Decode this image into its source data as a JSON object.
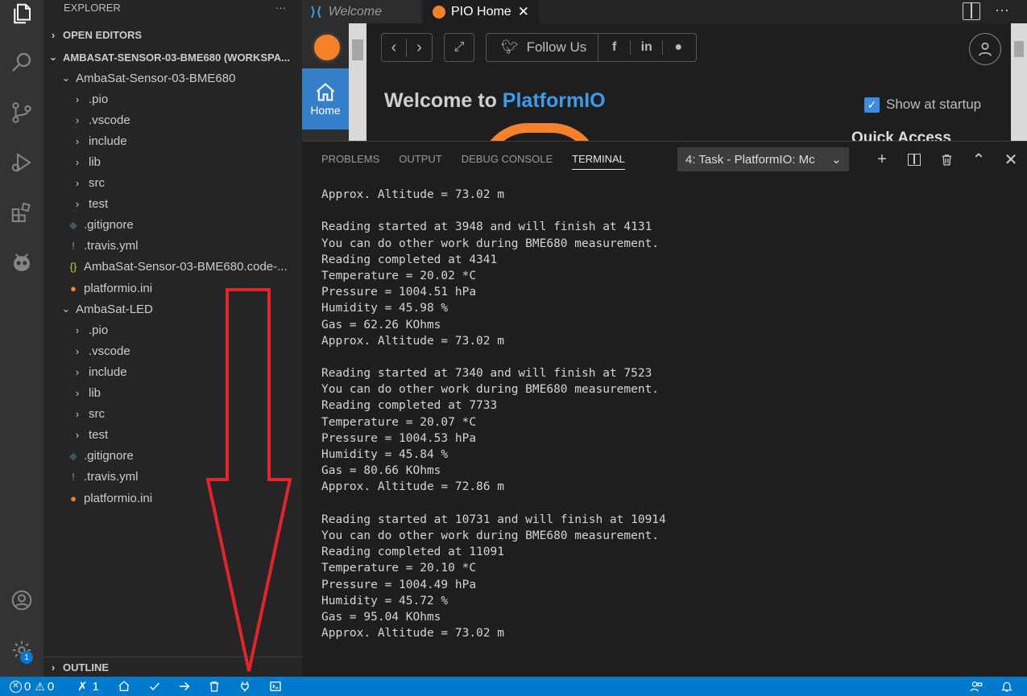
{
  "sidebar": {
    "title": "EXPLORER",
    "more": "···",
    "open_editors": "OPEN EDITORS",
    "workspace": "AMBASAT-SENSOR-03-BME680 (WORKSPA...",
    "projects": [
      {
        "name": "AmbaSat-Sensor-03-BME680",
        "items": [
          ".pio",
          ".vscode",
          "include",
          "lib",
          "src",
          "test",
          ".gitignore",
          ".travis.yml",
          "AmbaSat-Sensor-03-BME680.code-...",
          "platformio.ini"
        ]
      },
      {
        "name": "AmbaSat-LED",
        "items": [
          ".pio",
          ".vscode",
          "include",
          "lib",
          "src",
          "test",
          ".gitignore",
          ".travis.yml",
          "platformio.ini"
        ]
      }
    ],
    "outline": "OUTLINE",
    "settings_badge": "1"
  },
  "tabs": {
    "welcome": "Welcome",
    "pio_home": "PIO Home",
    "close": "✕"
  },
  "pio": {
    "home_label": "Home",
    "follow_us": "Follow Us",
    "welcome_prefix": "Welcome to ",
    "welcome_brand": "PlatformIO",
    "show_at_startup": "Show at startup",
    "quick_access": "Quick Access"
  },
  "panel": {
    "tabs": [
      "PROBLEMS",
      "OUTPUT",
      "DEBUG CONSOLE",
      "TERMINAL"
    ],
    "task_select": "4: Task - PlatformIO: Mc",
    "terminal_lines": [
      "Approx. Altitude = 73.02 m",
      "",
      "Reading started at 3948 and will finish at 4131",
      "You can do other work during BME680 measurement.",
      "Reading completed at 4341",
      "Temperature = 20.02 *C",
      "Pressure = 1004.51 hPa",
      "Humidity = 45.98 %",
      "Gas = 62.26 KOhms",
      "Approx. Altitude = 73.02 m",
      "",
      "Reading started at 7340 and will finish at 7523",
      "You can do other work during BME680 measurement.",
      "Reading completed at 7733",
      "Temperature = 20.07 *C",
      "Pressure = 1004.53 hPa",
      "Humidity = 45.84 %",
      "Gas = 80.66 KOhms",
      "Approx. Altitude = 72.86 m",
      "",
      "Reading started at 10731 and will finish at 10914",
      "You can do other work during BME680 measurement.",
      "Reading completed at 11091",
      "Temperature = 20.10 *C",
      "Pressure = 1004.49 hPa",
      "Humidity = 45.72 %",
      "Gas = 95.04 KOhms",
      "Approx. Altitude = 73.02 m"
    ]
  },
  "statusbar": {
    "errors": "0",
    "warnings": "0",
    "tasks": "1"
  },
  "colors": {
    "accent": "#007acc",
    "pio_orange": "#f5822a",
    "annotation_red": "#e0252b"
  }
}
